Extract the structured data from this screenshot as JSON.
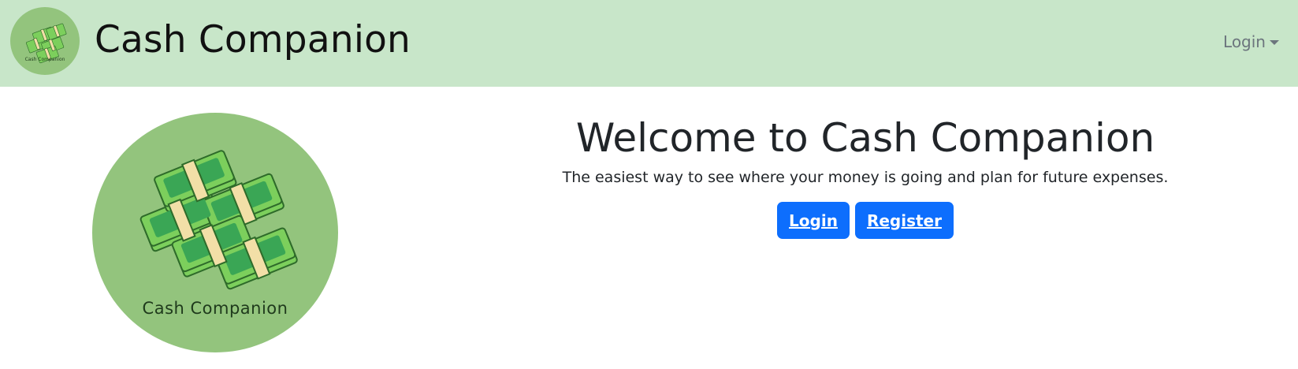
{
  "navbar": {
    "brand_title": "Cash Companion",
    "logo_caption": "Cash Companion",
    "login_dropdown_label": "Login"
  },
  "hero": {
    "logo_caption": "Cash Companion",
    "heading": "Welcome to Cash Companion",
    "tagline": "The easiest way to see where your money is going and plan for future expenses.",
    "login_button": "Login",
    "register_button": "Register"
  },
  "colors": {
    "navbar_bg": "#c8e6c9",
    "logo_circle": "#93c47d",
    "primary_button": "#0d6efd",
    "cash_green": "#3aa655",
    "cash_band": "#f2dfa7"
  }
}
